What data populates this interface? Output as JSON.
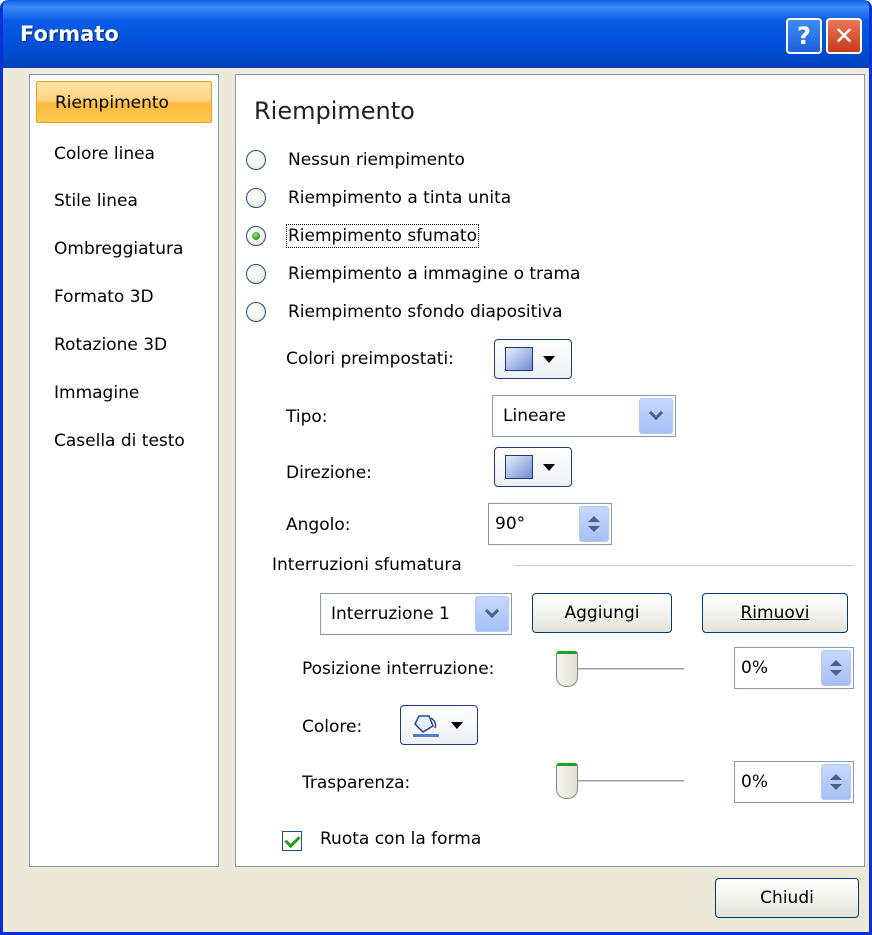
{
  "window": {
    "title": "Formato",
    "help_glyph": "?",
    "close_glyph": "✕"
  },
  "nav": {
    "items": [
      {
        "label": "Riempimento",
        "selected": true
      },
      {
        "label": "Colore linea"
      },
      {
        "label": "Stile linea"
      },
      {
        "label": "Ombreggiatura"
      },
      {
        "label": "Formato 3D"
      },
      {
        "label": "Rotazione 3D"
      },
      {
        "label": "Immagine"
      },
      {
        "label": "Casella di testo"
      }
    ]
  },
  "fill": {
    "title": "Riempimento",
    "options": [
      {
        "label": "Nessun riempimento",
        "checked": false
      },
      {
        "label": "Riempimento a tinta unita",
        "checked": false
      },
      {
        "label": "Riempimento sfumato",
        "checked": true
      },
      {
        "label": "Riempimento a immagine o trama",
        "checked": false
      },
      {
        "label": "Riempimento sfondo diapositiva",
        "checked": false
      }
    ],
    "preset_colors_label": "Colori preimpostati:",
    "type_label": "Tipo:",
    "type_value": "Lineare",
    "direction_label": "Direzione:",
    "angle_label": "Angolo:",
    "angle_value": "90°",
    "stops_group_label": "Interruzioni sfumatura",
    "stop_select_value": "Interruzione 1",
    "add_button": "Aggiungi",
    "remove_button": "Rimuovi",
    "stop_position_label": "Posizione interruzione:",
    "stop_position_value": "0%",
    "color_label": "Colore:",
    "transparency_label": "Trasparenza:",
    "transparency_value": "0%",
    "rotate_with_shape_label": "Ruota con la forma",
    "rotate_with_shape_checked": true
  },
  "footer": {
    "close_button": "Chiudi"
  },
  "colors": {
    "titlebar": "#0052dc",
    "dialog_bg": "#ece9d8",
    "selected_nav": "#ffc94f",
    "radio_checked": "#2f9f21"
  }
}
